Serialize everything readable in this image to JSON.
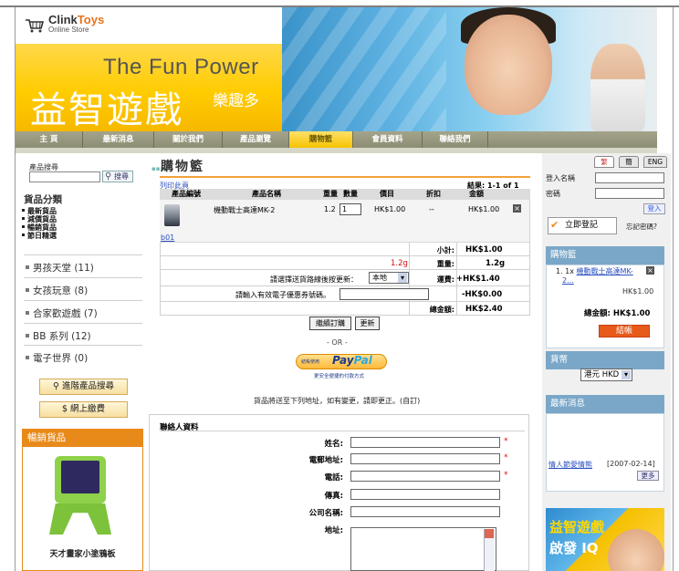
{
  "header": {
    "logo_prefix": "Clink",
    "logo_suffix": "Toys",
    "logo_sub": "Online Store",
    "tagline": "The Fun Power",
    "title_big": "益智遊戲",
    "title_small": "樂趣多"
  },
  "nav": [
    {
      "label": "主 頁",
      "active": false
    },
    {
      "label": "最新消息",
      "active": false
    },
    {
      "label": "關於我們",
      "active": false
    },
    {
      "label": "產品瀏覽",
      "active": false
    },
    {
      "label": "購物籃",
      "active": true
    },
    {
      "label": "會員資料",
      "active": false
    },
    {
      "label": "聯絡我們",
      "active": false
    }
  ],
  "left": {
    "search_label": "產品搜尋",
    "search_button": "搜尋",
    "categories_title": "貨品分類",
    "small_categories": [
      "最新貨品",
      "減價貨品",
      "暢銷貨品",
      "節日精選"
    ],
    "big_categories": [
      "男孩天堂 (11)",
      "女孩玩意 (8)",
      "合家歡遊戲 (7)",
      "BB 系列 (12)",
      "電子世界 (0)"
    ],
    "advanced_search": "進階產品搜尋",
    "online_payment": "網上繳費",
    "hot_title": "暢銷貨品",
    "hot_caption": "天才畫家小塗鴉板"
  },
  "cart": {
    "title": "購物籃",
    "print_link": "列印此頁",
    "results": "結果: 1-1 of 1",
    "columns": [
      "產品編號",
      "產品名稱",
      "重量",
      "數量",
      "價目",
      "折扣",
      "金額"
    ],
    "items": [
      {
        "code": "b01",
        "name": "機動戰士高達MK-2",
        "weight": "1.2",
        "qty": "1",
        "price": "HK$1.00",
        "discount": "--",
        "amount": "HK$1.00"
      }
    ],
    "subtotal_label": "小計:",
    "subtotal": "HK$1.00",
    "weight_red": "1.2g",
    "weight_label": "重量:",
    "weight": "1.2g",
    "shipping_prompt": "請選擇送貨路線後按更新：",
    "shipping_option": "本地",
    "shipping_label": "運費:",
    "shipping": "+HK$1.40",
    "coupon_prompt": "請輸入有效電子優惠券號碼。",
    "coupon_value": "-HK$0.00",
    "total_label": "總金額:",
    "total": "HK$2.40",
    "continue_button": "繼續訂購",
    "update_button": "更新",
    "or_text": "- OR -",
    "paypal_pre": "結帳使用",
    "paypal_word_a": "Pay",
    "paypal_word_b": "Pal",
    "paypal_sub": "更安全便捷的付款方式",
    "deliver_note": "貨品將送至下列地址，如有變更，請即更正。(自訂)"
  },
  "contact_form": {
    "title": "聯絡人資料",
    "fields": [
      {
        "label": "姓名:",
        "required": true
      },
      {
        "label": "電郵地址:",
        "required": true
      },
      {
        "label": "電話:",
        "required": true
      },
      {
        "label": "傳真:",
        "required": false
      },
      {
        "label": "公司名稱:",
        "required": false
      },
      {
        "label": "地址:",
        "required": false
      }
    ],
    "required_mark": "*"
  },
  "right": {
    "lang_tabs": [
      "繁",
      "簡",
      "ENG"
    ],
    "login_name_label": "登入名稱",
    "password_label": "密碼",
    "login_button": "登入",
    "register_button": "立即登記",
    "forgot": "忘記密碼?",
    "cart_title": "購物籃",
    "cart_item_prefix": "1. 1x ",
    "cart_item_link": "機動戰士高達MK-",
    "cart_item_link2": "2...",
    "cart_item_price": "HK$1.00",
    "cart_total": "總金額: HK$1.00",
    "checkout_button": "結帳",
    "currency_title": "貨幣",
    "currency_value": "港元 HKD",
    "news_title": "最新消息",
    "news_link": "情人節愛情熊",
    "news_date": "[2007-02-14]",
    "news_more": "更多",
    "promo_line1": "益智遊戲",
    "promo_line2": "啟發 IQ"
  }
}
